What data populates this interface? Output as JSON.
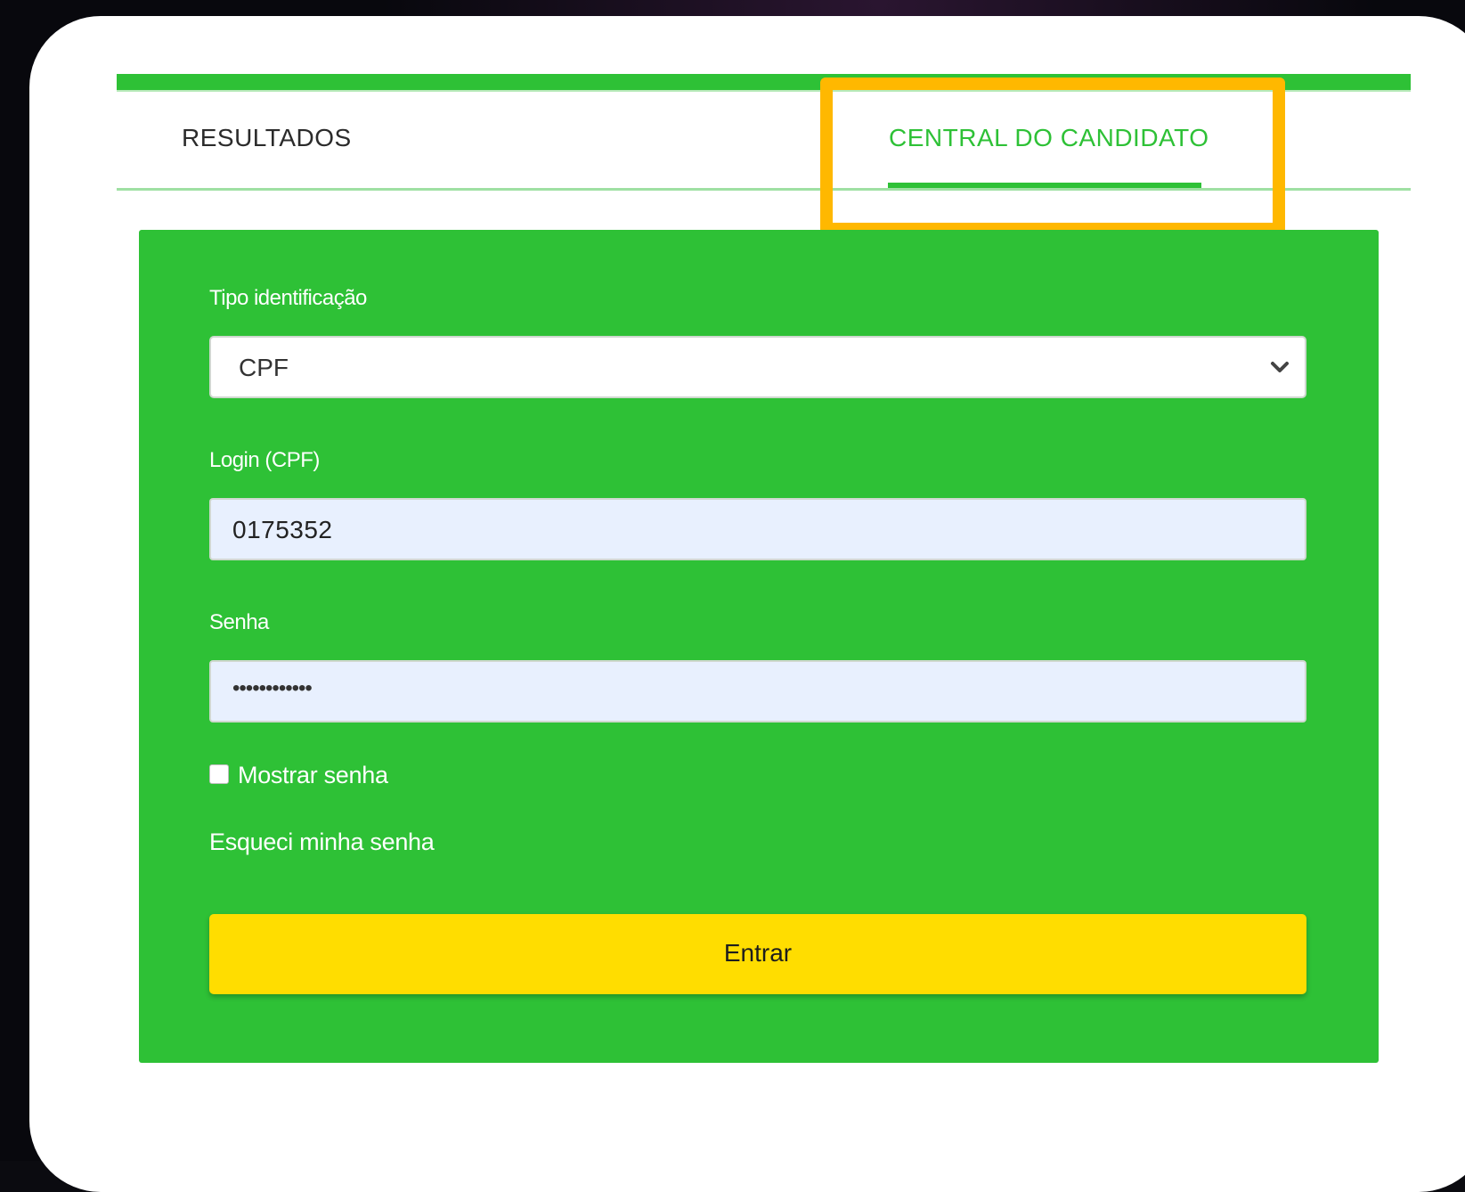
{
  "tabs": {
    "results_label": "RESULTADOS",
    "candidate_label": "CENTRAL DO CANDIDATO"
  },
  "form": {
    "id_type": {
      "label": "Tipo identificação",
      "selected": "CPF"
    },
    "login": {
      "label": "Login (CPF)",
      "value": "0175352"
    },
    "password": {
      "label": "Senha",
      "masked_value": "••••••••••••"
    },
    "show_password_label": "Mostrar senha",
    "forgot_password_label": "Esqueci minha senha",
    "submit_label": "Entrar"
  },
  "colors": {
    "brand_green": "#2ec136",
    "button_yellow": "#ffdd00",
    "highlight_orange": "#ffb800",
    "input_bg": "#e8f0fe"
  },
  "icons": {
    "select_arrow": "chevron-down-icon"
  }
}
